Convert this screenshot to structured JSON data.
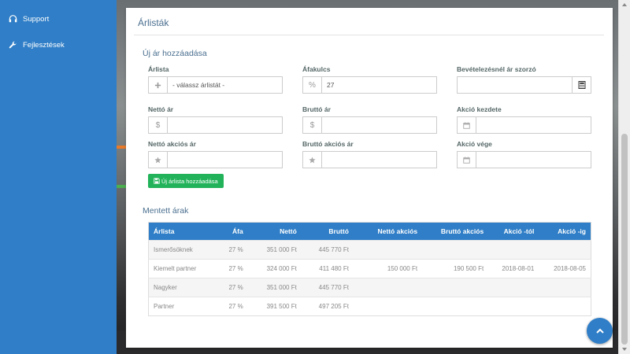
{
  "sidebar": {
    "items": [
      {
        "label": "Support",
        "icon": "headset-icon"
      },
      {
        "label": "Fejlesztések",
        "icon": "wrench-icon"
      }
    ]
  },
  "card": {
    "title": "Árlisták",
    "new_price_section": "Új ár hozzáadása",
    "fields": {
      "arlista": {
        "label": "Árlista",
        "value": "- válassz árlistát -"
      },
      "afakulcs": {
        "label": "Áfakulcs",
        "value": "27",
        "addon": "%"
      },
      "szorzo": {
        "label": "Bevételezésnél ár szorzó",
        "value": ""
      },
      "netto": {
        "label": "Nettó ár",
        "value": "",
        "addon": "$"
      },
      "brutto": {
        "label": "Bruttó ár",
        "value": "",
        "addon": "$"
      },
      "akcio_kezdete": {
        "label": "Akció kezdete",
        "value": ""
      },
      "netto_akcios": {
        "label": "Nettó akciós ár",
        "value": ""
      },
      "brutto_akcios": {
        "label": "Bruttó akciós ár",
        "value": ""
      },
      "akcio_vege": {
        "label": "Akció vége",
        "value": ""
      }
    },
    "add_button": "Új árlista hozzáadása",
    "saved_section": "Mentett árak",
    "table": {
      "headers": [
        "Árlista",
        "Áfa",
        "Nettó",
        "Bruttó",
        "Nettó akciós",
        "Bruttó akciós",
        "Akció -tól",
        "Akció -ig"
      ],
      "rows": [
        [
          "Ismerősöknek",
          "27 %",
          "351 000 Ft",
          "445 770 Ft",
          "",
          "",
          "",
          ""
        ],
        [
          "Kiemelt partner",
          "27 %",
          "324 000 Ft",
          "411 480 Ft",
          "150 000 Ft",
          "190 500 Ft",
          "2018-08-01",
          "2018-08-05"
        ],
        [
          "Nagyker",
          "27 %",
          "351 000 Ft",
          "445 770 Ft",
          "",
          "",
          "",
          ""
        ],
        [
          "Partner",
          "27 %",
          "391 500 Ft",
          "497 205 Ft",
          "",
          "",
          "",
          ""
        ]
      ]
    }
  },
  "colors": {
    "primary": "#2f7ec7",
    "success": "#22b35a",
    "title": "#4a6f8f"
  }
}
